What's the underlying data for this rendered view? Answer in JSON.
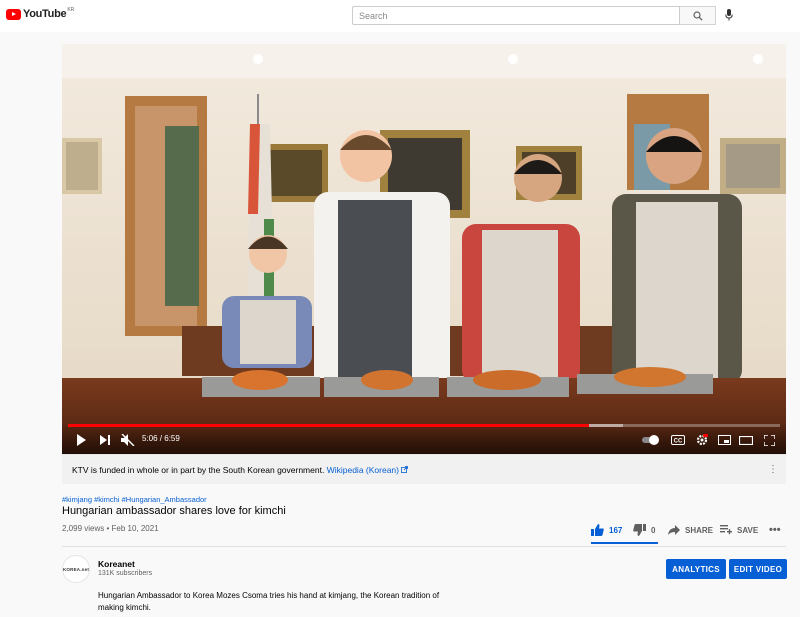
{
  "header": {
    "logo_text": "YouTube",
    "logo_sup": "KR",
    "search_placeholder": "Search"
  },
  "player": {
    "current_time": "5:06",
    "duration": "6:59",
    "time_display": "5:06 / 6:59",
    "played_fraction": 0.732,
    "loaded_fraction": 0.78
  },
  "info_panel": {
    "text": "KTV is funded in whole or in part by the South Korean government.",
    "link": "Wikipedia (Korean)"
  },
  "video": {
    "hashtags": "#kimjang #kimchi #Hungarian_Ambassador",
    "title": "Hungarian ambassador shares love for kimchi",
    "views_date": "2,099 views • Feb 10, 2021",
    "likes": "167",
    "dislikes": "0",
    "like_fraction": 1.0,
    "share_label": "SHARE",
    "save_label": "SAVE"
  },
  "channel": {
    "avatar_text": "KOREA.net",
    "name": "Koreanet",
    "subscribers": "131K subscribers",
    "analytics_label": "ANALYTICS",
    "edit_label": "EDIT VIDEO"
  },
  "description": "Hungarian Ambassador to Korea Mozes Csoma tries his hand at kimjang, the Korean tradition of making kimchi.",
  "colors": {
    "brand": "#ff0000",
    "accent": "#065fd4"
  }
}
